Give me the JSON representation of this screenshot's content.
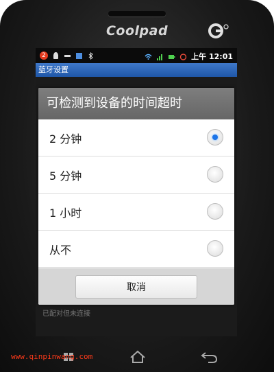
{
  "device": {
    "brand": "Coolpad"
  },
  "statusbar": {
    "notification_count": "2",
    "time": "上午 12:01"
  },
  "app": {
    "title": "蓝牙设置"
  },
  "background": {
    "partial_text": "已配对但未连接"
  },
  "dialog": {
    "title": "可检测到设备的时间超时",
    "options": [
      {
        "label": "2 分钟",
        "checked": true
      },
      {
        "label": "5 分钟",
        "checked": false
      },
      {
        "label": "1 小时",
        "checked": false
      },
      {
        "label": "从不",
        "checked": false
      }
    ],
    "cancel_label": "取消"
  },
  "watermark": "www.qinpinwang.com",
  "colors": {
    "accent": "#1b74e8",
    "titlebar": "#2b66b8"
  }
}
